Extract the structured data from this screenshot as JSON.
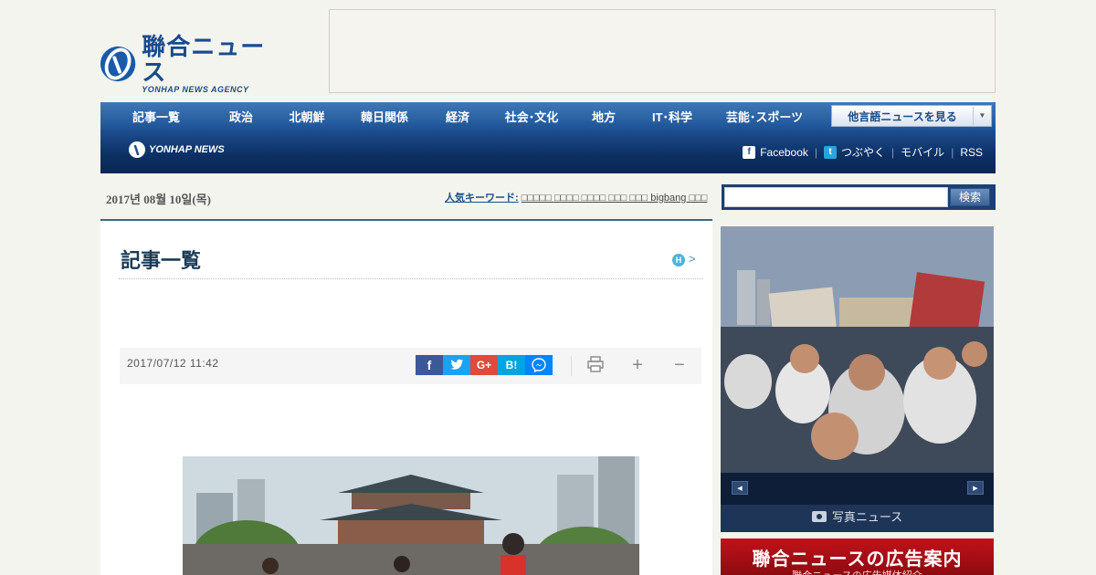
{
  "header": {
    "logo_jp": "聯合ニュース",
    "logo_en": "YONHAP NEWS AGENCY"
  },
  "nav": {
    "items": [
      "記事一覧",
      "政治",
      "北朝鮮",
      "韓日関係",
      "経済",
      "社会･文化",
      "地方",
      "IT･科学",
      "芸能･スポーツ"
    ],
    "lang_button": "他言語ニュースを見る"
  },
  "subnav": {
    "logo": "YONHAP NEWS",
    "links": [
      "Facebook",
      "つぶやく",
      "モバイル",
      "RSS"
    ]
  },
  "date": "2017년 08월 10일(목)",
  "ticker": {
    "label": "人気キーワード:",
    "items": "□□□□□ □□□□ □□□□ □□□ □□□ bigbang □□□"
  },
  "search": {
    "value": "",
    "button": "検索"
  },
  "main": {
    "title": "記事一覧",
    "h_badge": "H",
    "h_arrow": ">",
    "timestamp": "2017/07/12 11:42",
    "share": {
      "facebook": "f",
      "twitter": "t",
      "googleplus": "G+",
      "hatena": "B!",
      "messenger": "m"
    },
    "tools": {
      "plus": "+",
      "minus": "−"
    }
  },
  "right": {
    "photo_news_label": "写真ニュース",
    "ad_title": "聯合ニュースの広告案内",
    "ad_sub": "聯合ニュースの広告媒体紹介"
  },
  "colors": {
    "brand_blue": "#1a4a8c",
    "nav_top": "#2b63a6",
    "nav_sub": "#0d2f63",
    "ad_red": "#c0121a"
  }
}
